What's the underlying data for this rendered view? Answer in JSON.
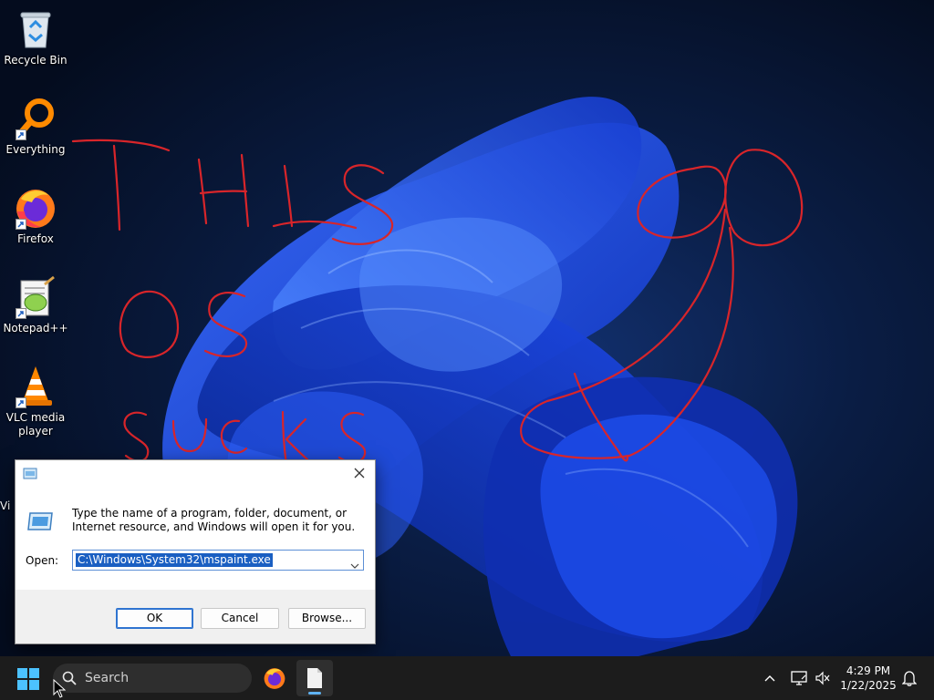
{
  "desktop": {
    "icons": [
      {
        "label": "Recycle Bin",
        "icon": "recycle-bin-icon",
        "shortcut": false
      },
      {
        "label": "Everything",
        "icon": "everything-search-icon",
        "shortcut": true
      },
      {
        "label": "Firefox",
        "icon": "firefox-icon",
        "shortcut": true
      },
      {
        "label": "Notepad++",
        "icon": "notepad-plus-plus-icon",
        "shortcut": true
      },
      {
        "label": "VLC media player",
        "icon": "vlc-icon",
        "shortcut": true
      }
    ],
    "partial_label": "Vi",
    "scribble_color": "#d8252a",
    "handwriting": "THIS OS SUCKS"
  },
  "run_dialog": {
    "description": "Type the name of a program, folder, document, or Internet resource, and Windows will open it for you.",
    "open_label": "Open:",
    "open_value": "C:\\Windows\\System32\\mspaint.exe",
    "ok_label": "OK",
    "cancel_label": "Cancel",
    "browse_label": "Browse..."
  },
  "taskbar": {
    "search_placeholder": "Search",
    "clock_time": "4:29 PM",
    "clock_date": "1/22/2025",
    "accent_color": "#5fb2f2"
  }
}
